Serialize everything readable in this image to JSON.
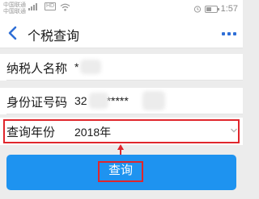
{
  "status_bar": {
    "carrier_1": "中国联通",
    "carrier_2": "中国联通",
    "network_badge": "HD",
    "time": "1:57",
    "battery_percent": 40,
    "icons": [
      "signal-icon",
      "wifi-icon",
      "alarm-icon",
      "battery-icon"
    ]
  },
  "header": {
    "title": "个税查询",
    "back_icon": "chevron-left-icon",
    "more_icon": "more-dots-icon"
  },
  "form": {
    "taxpayer_name_label": "纳税人名称",
    "taxpayer_name_value": "*",
    "id_number_label": "身份证号码",
    "id_number_value": "32",
    "id_number_masked": "*****",
    "query_year_label": "查询年份",
    "query_year_value": "2018年"
  },
  "actions": {
    "query_button_label": "查询"
  },
  "colors": {
    "accent_blue": "#1e93f0",
    "highlight_red": "#e0262c",
    "icon_blue": "#2f6fd6"
  }
}
